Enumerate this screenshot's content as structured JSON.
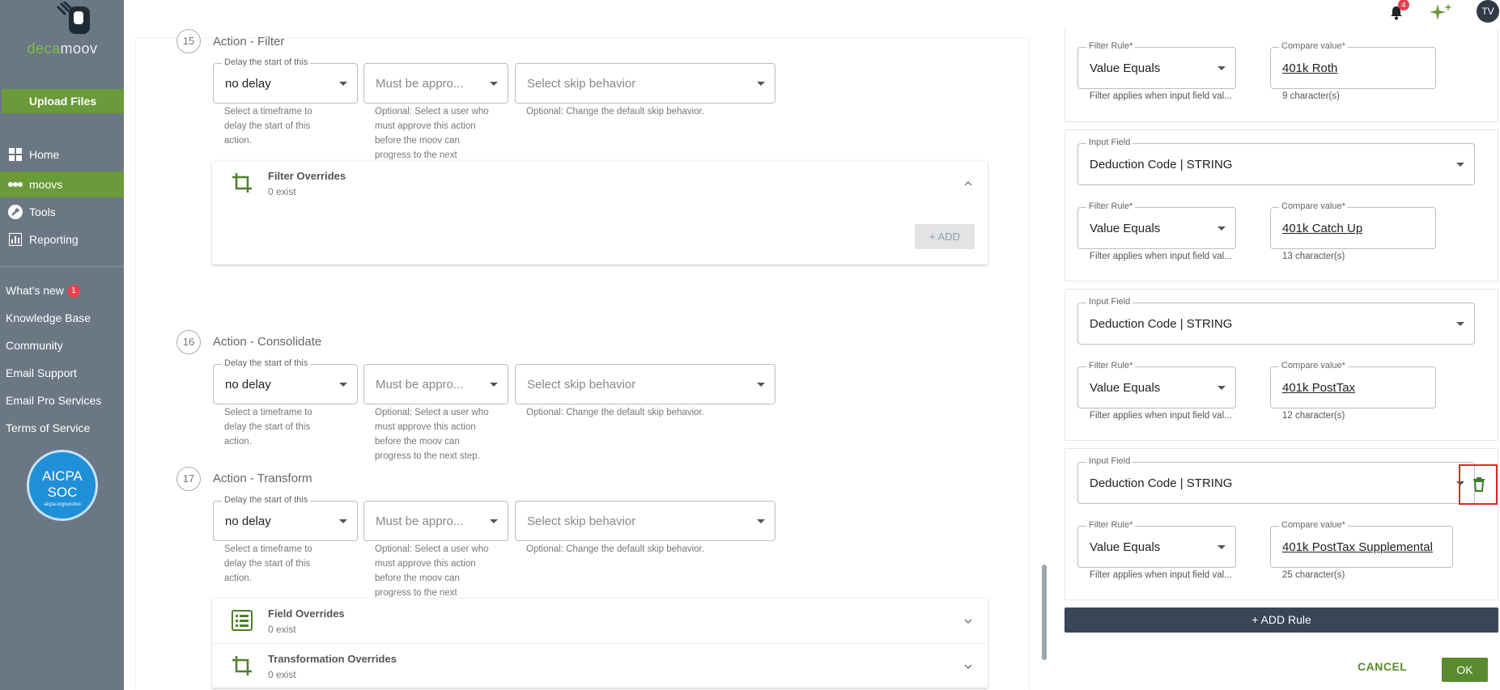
{
  "app": {
    "logo_text_1": "deca",
    "logo_text_2": "moov"
  },
  "sidebar": {
    "upload_label": "Upload Files",
    "nav": [
      {
        "label": "Home",
        "icon": "grid-icon"
      },
      {
        "label": "moovs",
        "icon": "moovs-icon"
      },
      {
        "label": "Tools",
        "icon": "wrench-icon"
      },
      {
        "label": "Reporting",
        "icon": "chart-icon"
      }
    ],
    "links": [
      {
        "label": "What's new",
        "badge": "1"
      },
      {
        "label": "Knowledge Base"
      },
      {
        "label": "Community"
      },
      {
        "label": "Email Support"
      },
      {
        "label": "Email Pro Services"
      },
      {
        "label": "Terms of Service"
      }
    ],
    "aicpa": {
      "line1": "AICPA",
      "line2": "SOC",
      "line3": "aicpa.org/soc4so"
    }
  },
  "topbar": {
    "notification_count": "4",
    "avatar_initials": "TV"
  },
  "steps": [
    {
      "number": "15",
      "title": "Action - Filter"
    },
    {
      "number": "16",
      "title": "Action - Consolidate"
    },
    {
      "number": "17",
      "title": "Action - Transform"
    }
  ],
  "step_fields": {
    "delay_label": "Delay the start of this",
    "delay_value": "no delay",
    "approve_placeholder": "Must be appro...",
    "skip_placeholder": "Select skip behavior",
    "delay_help": "Select a timeframe to delay the start of this action.",
    "approve_help_15": "Optional: Select a user who must approve this action before the moov can progress to the next",
    "approve_help_16": "Optional: Select a user who must approve this action before the moov can progress to the next step.",
    "approve_help_17": "Optional: Select a user who must approve this action before the moov can progress to the next",
    "skip_help": "Optional: Change the default skip behavior."
  },
  "overrides": {
    "filter": {
      "title": "Filter Overrides",
      "count": "0 exist",
      "add_label": "+ ADD"
    },
    "field": {
      "title": "Field Overrides",
      "count": "0 exist"
    },
    "transformation": {
      "title": "Transformation Overrides",
      "count": "0 exist"
    }
  },
  "rules_panel": {
    "input_field_label": "Input Field",
    "filter_rule_label": "Filter Rule*",
    "compare_label": "Compare value*",
    "filter_help": "Filter applies when input field val...",
    "rules": [
      {
        "input": "",
        "rule": "Value Equals",
        "compare": "401k Roth",
        "chars": "9 character(s)"
      },
      {
        "input": "Deduction Code | STRING",
        "rule": "Value Equals",
        "compare": "401k Catch Up",
        "chars": "13 character(s)"
      },
      {
        "input": "Deduction Code | STRING",
        "rule": "Value Equals",
        "compare": "401k PostTax",
        "chars": "12 character(s)"
      },
      {
        "input": "Deduction Code | STRING",
        "rule": "Value Equals",
        "compare": "401k PostTax Supplemental",
        "chars": "25 character(s)"
      }
    ],
    "add_rule_label": "+ ADD Rule",
    "cancel_label": "CANCEL",
    "ok_label": "OK"
  },
  "colors": {
    "sidebar": "#6b7784",
    "accent_green": "#6a9a3a",
    "add_rule_bg": "#3a4556",
    "highlight_red": "#e02424"
  }
}
